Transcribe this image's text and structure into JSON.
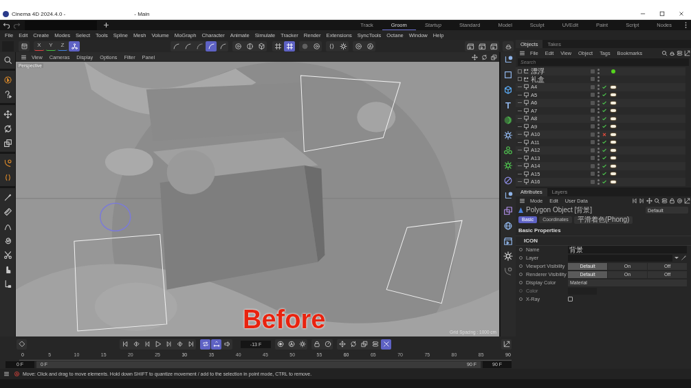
{
  "window": {
    "title": "Cinema 4D 2024.4.0 -",
    "title_suffix": "- Main"
  },
  "layouts": [
    {
      "label": "Track",
      "selected": false,
      "italic": false
    },
    {
      "label": "Groom",
      "selected": true,
      "italic": false
    },
    {
      "label": "Startup",
      "selected": false,
      "italic": true
    },
    {
      "label": "Standard",
      "selected": false,
      "italic": false
    },
    {
      "label": "Model",
      "selected": false,
      "italic": false
    },
    {
      "label": "Sculpt",
      "selected": false,
      "italic": false
    },
    {
      "label": "UVEdit",
      "selected": false,
      "italic": false
    },
    {
      "label": "Paint",
      "selected": false,
      "italic": false
    },
    {
      "label": "Script",
      "selected": false,
      "italic": false
    },
    {
      "label": "Nodes",
      "selected": false,
      "italic": false
    }
  ],
  "menu": [
    "File",
    "Edit",
    "Create",
    "Modes",
    "Select",
    "Tools",
    "Spline",
    "Mesh",
    "Volume",
    "MoGraph",
    "Character",
    "Animate",
    "Simulate",
    "Tracker",
    "Render",
    "Extensions",
    "SyncTools",
    "Octane",
    "Window",
    "Help"
  ],
  "toolbar": [
    {
      "items": [
        {
          "kind": "panel",
          "active": false
        }
      ]
    },
    {
      "items": [
        {
          "kind": "axis-label",
          "label": "X",
          "color": "#e04040",
          "active": false
        },
        {
          "kind": "axis-label",
          "label": "Y",
          "color": "#40c040",
          "active": false
        },
        {
          "kind": "axis-label",
          "label": "Z",
          "color": "#4080e0",
          "active": false
        },
        {
          "kind": "axis",
          "active": true
        }
      ]
    },
    {
      "items": [
        {
          "kind": "arc",
          "active": false
        },
        {
          "kind": "arc",
          "active": false
        },
        {
          "kind": "dotted-arc",
          "active": false
        },
        {
          "kind": "arc",
          "active": true
        },
        {
          "kind": "arc",
          "active": false
        }
      ]
    },
    {
      "items": [
        {
          "kind": "target",
          "active": false
        },
        {
          "kind": "half-circle",
          "active": false
        },
        {
          "kind": "cube",
          "active": false
        }
      ]
    },
    {
      "items": [
        {
          "kind": "grid",
          "active": false
        },
        {
          "kind": "grid",
          "active": true
        }
      ]
    },
    {
      "items": [
        {
          "kind": "dot",
          "active": false
        },
        {
          "kind": "target",
          "active": false
        }
      ]
    },
    {
      "items": [
        {
          "kind": "symmetry",
          "active": false
        },
        {
          "kind": "gear",
          "active": false
        }
      ]
    },
    {
      "items": [
        {
          "kind": "target",
          "active": false
        },
        {
          "kind": "circle",
          "active": false
        }
      ]
    },
    {
      "items": [
        {
          "kind": "clapper",
          "active": false
        },
        {
          "kind": "clapper",
          "active": false
        },
        {
          "kind": "clapper",
          "active": false
        }
      ]
    },
    {
      "items": [
        {
          "kind": "bowl",
          "active": false
        }
      ]
    }
  ],
  "left_tools": [
    {
      "kind": "search"
    },
    {
      "kind": "selection"
    },
    {
      "kind": "help"
    },
    {
      "kind": "move"
    },
    {
      "kind": "rotate"
    },
    {
      "kind": "scale"
    },
    {
      "kind": "pen"
    },
    {
      "kind": "symmetry"
    },
    {
      "kind": "brush"
    },
    {
      "kind": "comb"
    },
    {
      "kind": "arch"
    },
    {
      "kind": "spiral"
    },
    {
      "kind": "scissors"
    },
    {
      "kind": "hand"
    },
    {
      "kind": "bend"
    }
  ],
  "viewport": {
    "menu": [
      "View",
      "Cameras",
      "Display",
      "Options",
      "Filter",
      "Panel"
    ],
    "camera": "Perspective",
    "overlay_text": "Before",
    "grid_spacing": "Grid Spacing : 1000 cm",
    "kind": "picture"
  },
  "object_strip": [
    {
      "kind": "node"
    },
    {
      "kind": "square"
    },
    {
      "kind": "cube"
    },
    {
      "kind": "letter",
      "label": "T"
    },
    {
      "kind": "sphere"
    },
    {
      "kind": "gear"
    },
    {
      "kind": "cluster"
    },
    {
      "kind": "gear"
    },
    {
      "kind": "ring"
    },
    {
      "kind": "node"
    },
    {
      "kind": "scale"
    },
    {
      "kind": "globe"
    },
    {
      "kind": "clapper"
    },
    {
      "kind": "sun"
    },
    {
      "kind": "pen"
    }
  ],
  "objects_panel": {
    "tabs": [
      {
        "label": "Objects",
        "selected": true
      },
      {
        "label": "Takes",
        "selected": false
      }
    ],
    "menu": [
      "File",
      "Edit",
      "View",
      "Object",
      "Tags",
      "Bookmarks"
    ],
    "search": {
      "placeholder": "Search"
    },
    "objects": [
      {
        "name": "漂浮",
        "kind": "group",
        "expanded": false,
        "tags": [
          {
            "kind": "dot"
          }
        ]
      },
      {
        "name": "礼盒",
        "kind": "group",
        "expanded": false
      },
      {
        "name": "A4",
        "kind": "mesh",
        "enabled": true,
        "tags": [
          {
            "kind": "material"
          }
        ]
      },
      {
        "name": "A5",
        "kind": "mesh",
        "enabled": true,
        "tags": [
          {
            "kind": "material"
          }
        ]
      },
      {
        "name": "A6",
        "kind": "mesh",
        "enabled": true,
        "tags": [
          {
            "kind": "material"
          }
        ]
      },
      {
        "name": "A7",
        "kind": "mesh",
        "enabled": true,
        "tags": [
          {
            "kind": "material"
          }
        ]
      },
      {
        "name": "A8",
        "kind": "mesh",
        "enabled": true,
        "tags": [
          {
            "kind": "material"
          }
        ]
      },
      {
        "name": "A9",
        "kind": "mesh",
        "enabled": true,
        "tags": [
          {
            "kind": "material"
          }
        ]
      },
      {
        "name": "A10",
        "kind": "mesh",
        "enabled": false,
        "tags": [
          {
            "kind": "material"
          }
        ]
      },
      {
        "name": "A11",
        "kind": "mesh",
        "enabled": true,
        "tags": [
          {
            "kind": "material"
          }
        ]
      },
      {
        "name": "A12",
        "kind": "mesh",
        "enabled": true,
        "tags": [
          {
            "kind": "material"
          }
        ]
      },
      {
        "name": "A13",
        "kind": "mesh",
        "enabled": true,
        "tags": [
          {
            "kind": "material"
          }
        ]
      },
      {
        "name": "A14",
        "kind": "mesh",
        "enabled": true,
        "tags": [
          {
            "kind": "material"
          }
        ]
      },
      {
        "name": "A15",
        "kind": "mesh",
        "enabled": true,
        "tags": [
          {
            "kind": "material"
          }
        ]
      },
      {
        "name": "A16",
        "kind": "mesh",
        "enabled": true,
        "tags": [
          {
            "kind": "material"
          }
        ]
      }
    ]
  },
  "attributes": {
    "tabs": [
      {
        "label": "Attributes",
        "selected": true
      },
      {
        "label": "Layers",
        "selected": false
      }
    ],
    "menu": [
      "Mode",
      "Edit",
      "User Data"
    ],
    "object_type": "Polygon Object [背景]",
    "preset": "Default",
    "pages": [
      {
        "label": "Basic",
        "selected": true,
        "kind": "page"
      },
      {
        "label": "Coordinates",
        "selected": false,
        "kind": "page"
      },
      {
        "label": "平滑着色(Phong)",
        "selected": false,
        "kind": "tag"
      }
    ],
    "section": "Basic Properties",
    "group": "ICON",
    "fields": [
      {
        "kind": "text",
        "label": "Name",
        "value": "背景",
        "disabled": false
      },
      {
        "kind": "link",
        "label": "Layer",
        "disabled": false
      },
      {
        "kind": "segmented",
        "label": "Viewport Visibility",
        "disabled": false,
        "options": [
          {
            "label": "Default",
            "selected": true
          },
          {
            "label": "On",
            "selected": false
          },
          {
            "label": "Off",
            "selected": false
          }
        ]
      },
      {
        "kind": "segmented",
        "label": "Renderer Visibility",
        "disabled": false,
        "options": [
          {
            "label": "Default",
            "selected": true
          },
          {
            "label": "On",
            "selected": false
          },
          {
            "label": "Off",
            "selected": false
          }
        ]
      },
      {
        "kind": "dropdown",
        "label": "Display Color",
        "value": "Material",
        "disabled": false
      },
      {
        "kind": "color",
        "label": "Color",
        "disabled": true
      },
      {
        "kind": "checkbox",
        "label": "X-Ray",
        "checked": false,
        "disabled": false
      }
    ]
  },
  "timeline": {
    "left": [
      {
        "kind": "diamond",
        "active": false
      }
    ],
    "transport": [
      {
        "kind": "first",
        "active": false
      },
      {
        "kind": "prev-key",
        "active": false
      },
      {
        "kind": "prev-frame",
        "active": false
      },
      {
        "kind": "play",
        "active": false
      },
      {
        "kind": "next-frame",
        "active": false
      },
      {
        "kind": "next-key",
        "active": false
      },
      {
        "kind": "last",
        "active": false
      }
    ],
    "loop": [
      {
        "kind": "loop",
        "active": true
      },
      {
        "kind": "key-range",
        "active": true
      },
      {
        "kind": "speaker",
        "active": false
      }
    ],
    "frame": "-13 F",
    "record": [
      {
        "kind": "record",
        "active": false
      },
      {
        "kind": "autokey",
        "active": false
      },
      {
        "kind": "gear",
        "active": false
      }
    ],
    "keys": [
      {
        "kind": "lock",
        "active": false
      },
      {
        "kind": "motion",
        "active": false
      }
    ],
    "key_tools": [
      {
        "kind": "move",
        "active": false
      },
      {
        "kind": "rotate",
        "active": false
      },
      {
        "kind": "scale",
        "active": false
      },
      {
        "kind": "toggle",
        "active": false
      },
      {
        "kind": "snap",
        "active": true
      }
    ],
    "right": [
      {
        "kind": "graph",
        "active": false
      }
    ],
    "ticks": [
      "0",
      "5",
      "10",
      "15",
      "20",
      "25",
      "30",
      "35",
      "40",
      "45",
      "50",
      "55",
      "60",
      "65",
      "70",
      "75",
      "80",
      "85",
      "90"
    ],
    "start": "0 F",
    "range_start": "0 F",
    "range_end": "90 F",
    "end": "90 F",
    "range": {
      "level": 1
    }
  },
  "status": {
    "message": "Move: Click and drag to move elements. Hold down SHIFT to quantize movement / add to the selection in point mode, CTRL to remove."
  }
}
